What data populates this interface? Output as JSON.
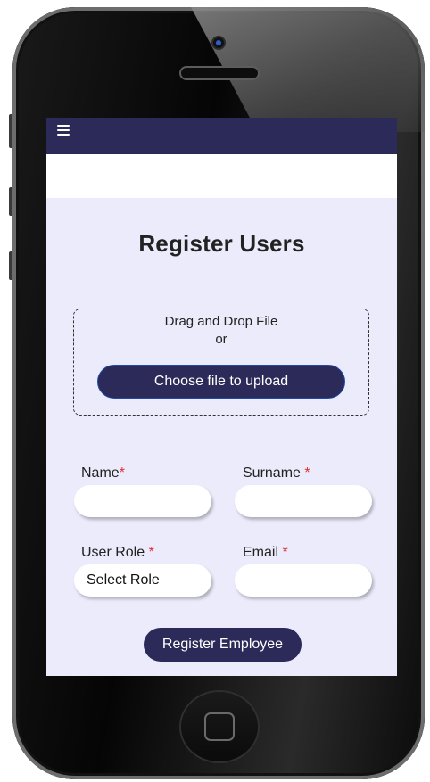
{
  "header": {
    "menu_icon": "hamburger-menu-icon"
  },
  "page": {
    "title": "Register Users"
  },
  "upload": {
    "drag_text": "Drag and Drop File",
    "or_text": "or",
    "button_label": "Choose file to upload"
  },
  "form": {
    "required_marker": "*",
    "name": {
      "label": "Name",
      "value": ""
    },
    "surname": {
      "label": "Surname ",
      "value": ""
    },
    "user_role": {
      "label": "User Role ",
      "selected": "Select Role"
    },
    "email": {
      "label": "Email ",
      "value": ""
    },
    "submit_label": "Register Employee"
  },
  "colors": {
    "primary": "#2c2a58",
    "screen_background": "#ebebfb",
    "required": "#e03030"
  }
}
